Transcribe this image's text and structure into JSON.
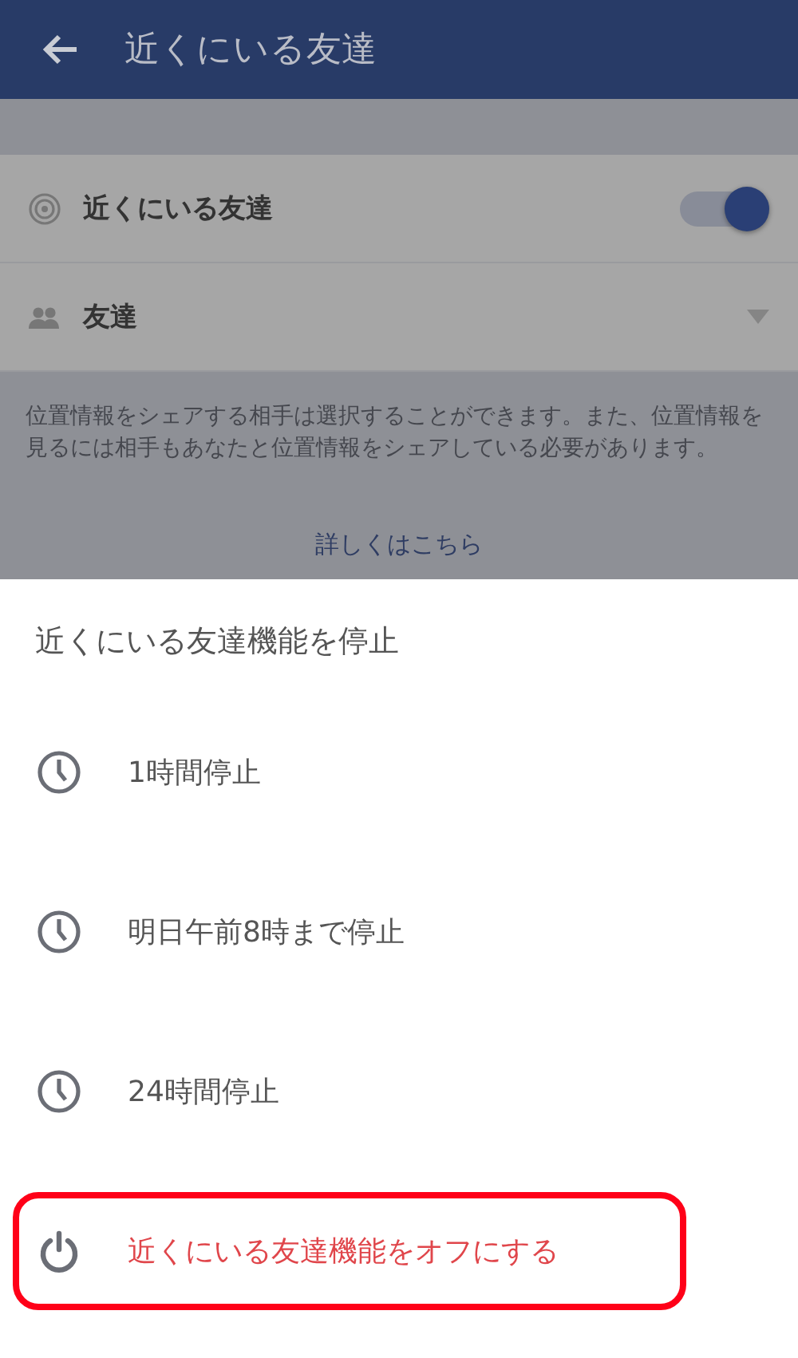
{
  "header": {
    "title": "近くにいる友達"
  },
  "settings": [
    {
      "kind": "toggle",
      "label": "近くにいる友達",
      "on": true
    },
    {
      "kind": "dropdown",
      "label": "友達"
    }
  ],
  "description": "位置情報をシェアする相手は選択することができます。また、位置情報を見るには相手もあなたと位置情報をシェアしている必要があります。",
  "link": "詳しくはこちら",
  "sheet": {
    "title": "近くにいる友達機能を停止",
    "items": [
      {
        "kind": "clock",
        "label": "1時間停止",
        "highlighted": false
      },
      {
        "kind": "clock",
        "label": "明日午前8時まで停止",
        "highlighted": false
      },
      {
        "kind": "clock",
        "label": "24時間停止",
        "highlighted": false
      },
      {
        "kind": "power",
        "label": "近くにいる友達機能をオフにする",
        "highlighted": true
      }
    ]
  }
}
